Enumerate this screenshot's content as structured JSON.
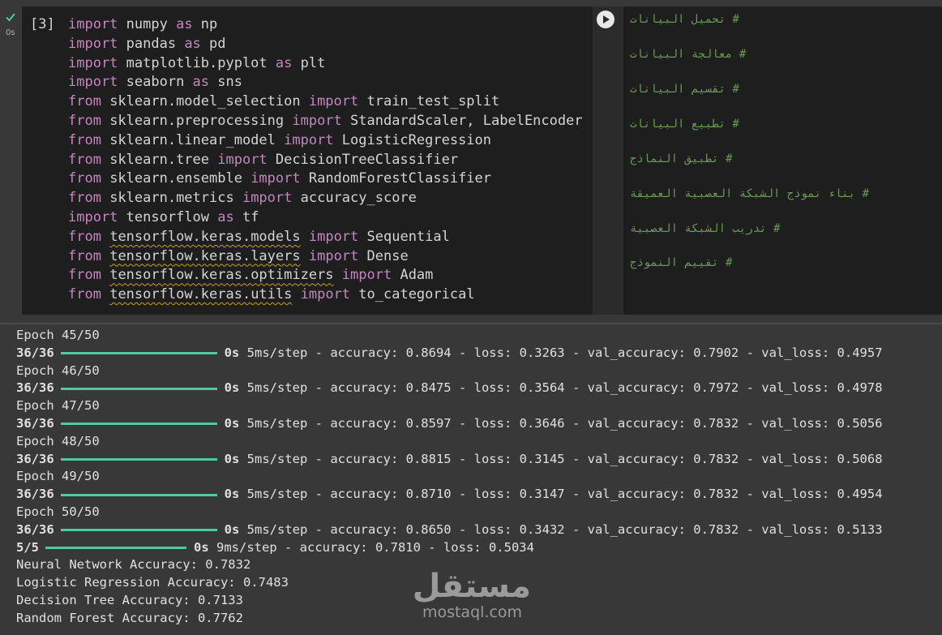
{
  "cell": {
    "status": "completed",
    "exec_time": "0s",
    "exec_count": "[3]",
    "status_color": "#4ec9a4",
    "code_lines": [
      [
        {
          "t": "import",
          "k": 1
        },
        {
          "t": " numpy "
        },
        {
          "t": "as",
          "k": 1
        },
        {
          "t": " np"
        }
      ],
      [
        {
          "t": "import",
          "k": 1
        },
        {
          "t": " pandas "
        },
        {
          "t": "as",
          "k": 1
        },
        {
          "t": " pd"
        }
      ],
      [
        {
          "t": "import",
          "k": 1
        },
        {
          "t": " matplotlib.pyplot "
        },
        {
          "t": "as",
          "k": 1
        },
        {
          "t": " plt"
        }
      ],
      [
        {
          "t": "import",
          "k": 1
        },
        {
          "t": " seaborn "
        },
        {
          "t": "as",
          "k": 1
        },
        {
          "t": " sns"
        }
      ],
      [
        {
          "t": "from",
          "k": 1
        },
        {
          "t": " sklearn.model_selection "
        },
        {
          "t": "import",
          "k": 1
        },
        {
          "t": " train_test_split"
        }
      ],
      [
        {
          "t": "from",
          "k": 1
        },
        {
          "t": " sklearn.preprocessing "
        },
        {
          "t": "import",
          "k": 1
        },
        {
          "t": " StandardScaler, LabelEncoder"
        }
      ],
      [
        {
          "t": "from",
          "k": 1
        },
        {
          "t": " sklearn.linear_model "
        },
        {
          "t": "import",
          "k": 1
        },
        {
          "t": " LogisticRegression"
        }
      ],
      [
        {
          "t": "from",
          "k": 1
        },
        {
          "t": " sklearn.tree "
        },
        {
          "t": "import",
          "k": 1
        },
        {
          "t": " DecisionTreeClassifier"
        }
      ],
      [
        {
          "t": "from",
          "k": 1
        },
        {
          "t": " sklearn.ensemble "
        },
        {
          "t": "import",
          "k": 1
        },
        {
          "t": " RandomForestClassifier"
        }
      ],
      [
        {
          "t": "from",
          "k": 1
        },
        {
          "t": " sklearn.metrics "
        },
        {
          "t": "import",
          "k": 1
        },
        {
          "t": " accuracy_score"
        }
      ],
      [
        {
          "t": "import",
          "k": 1
        },
        {
          "t": " tensorflow "
        },
        {
          "t": "as",
          "k": 1
        },
        {
          "t": " tf"
        }
      ],
      [
        {
          "t": "from",
          "k": 1
        },
        {
          "t": " "
        },
        {
          "t": "tensorflow.keras.models",
          "w": 1
        },
        {
          "t": " "
        },
        {
          "t": "import",
          "k": 1
        },
        {
          "t": " Sequential"
        }
      ],
      [
        {
          "t": "from",
          "k": 1
        },
        {
          "t": " "
        },
        {
          "t": "tensorflow.keras.layers",
          "w": 1
        },
        {
          "t": " "
        },
        {
          "t": "import",
          "k": 1
        },
        {
          "t": " Dense"
        }
      ],
      [
        {
          "t": "from",
          "k": 1
        },
        {
          "t": " "
        },
        {
          "t": "tensorflow.keras.optimizers",
          "w": 1
        },
        {
          "t": " "
        },
        {
          "t": "import",
          "k": 1
        },
        {
          "t": " Adam"
        }
      ],
      [
        {
          "t": "from",
          "k": 1
        },
        {
          "t": " "
        },
        {
          "t": "tensorflow.keras.utils",
          "w": 1
        },
        {
          "t": " "
        },
        {
          "t": "import",
          "k": 1
        },
        {
          "t": " to_categorical"
        }
      ]
    ],
    "comments": [
      "# تحميل البيانات",
      "# معالجة البيانات",
      "# تقسيم البيانات",
      "# تطبيع البيانات",
      "# تطبيق النماذج",
      "# بناء نموذج الشبكة العصبية العميقة",
      "# تدريب الشبكة العصبية",
      "# تقييم النموذج"
    ]
  },
  "output": {
    "lines": [
      {
        "type": "text",
        "text": "Epoch 45/50"
      },
      {
        "type": "progress",
        "steps": "36/36",
        "bar_fraction": 1.0,
        "time": "0s",
        "rest": "5ms/step - accuracy: 0.8694 - loss: 0.3263 - val_accuracy: 0.7902 - val_loss: 0.4957"
      },
      {
        "type": "text",
        "text": "Epoch 46/50"
      },
      {
        "type": "progress",
        "steps": "36/36",
        "bar_fraction": 1.0,
        "time": "0s",
        "rest": "5ms/step - accuracy: 0.8475 - loss: 0.3564 - val_accuracy: 0.7972 - val_loss: 0.4978"
      },
      {
        "type": "text",
        "text": "Epoch 47/50"
      },
      {
        "type": "progress",
        "steps": "36/36",
        "bar_fraction": 1.0,
        "time": "0s",
        "rest": "5ms/step - accuracy: 0.8597 - loss: 0.3646 - val_accuracy: 0.7832 - val_loss: 0.5056"
      },
      {
        "type": "text",
        "text": "Epoch 48/50"
      },
      {
        "type": "progress",
        "steps": "36/36",
        "bar_fraction": 1.0,
        "time": "0s",
        "rest": "5ms/step - accuracy: 0.8815 - loss: 0.3145 - val_accuracy: 0.7832 - val_loss: 0.5068"
      },
      {
        "type": "text",
        "text": "Epoch 49/50"
      },
      {
        "type": "progress",
        "steps": "36/36",
        "bar_fraction": 1.0,
        "time": "0s",
        "rest": "5ms/step - accuracy: 0.8710 - loss: 0.3147 - val_accuracy: 0.7832 - val_loss: 0.4954"
      },
      {
        "type": "text",
        "text": "Epoch 50/50"
      },
      {
        "type": "progress",
        "steps": "36/36",
        "bar_fraction": 1.0,
        "time": "0s",
        "rest": "5ms/step - accuracy: 0.8650 - loss: 0.3432 - val_accuracy: 0.7832 - val_loss: 0.5133"
      },
      {
        "type": "progress",
        "steps": "5/5",
        "bar_fraction": 1.0,
        "time": "0s",
        "rest": "9ms/step - accuracy: 0.7810 - loss: 0.5034"
      },
      {
        "type": "text",
        "text": "Neural Network Accuracy: 0.7832"
      },
      {
        "type": "text",
        "text": "Logistic Regression Accuracy: 0.7483"
      },
      {
        "type": "text",
        "text": "Decision Tree Accuracy: 0.7133"
      },
      {
        "type": "text",
        "text": "Random Forest Accuracy: 0.7762"
      }
    ],
    "progress_color": "#4ec9a4"
  },
  "watermark": {
    "arabic": "مستقل",
    "latin": "mostaql.com"
  }
}
